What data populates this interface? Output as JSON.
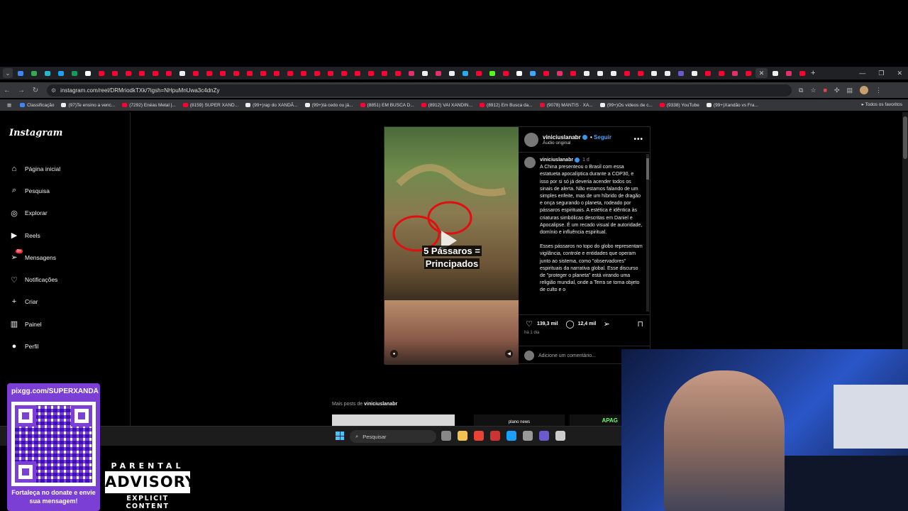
{
  "browser": {
    "tabs_favicon_colors": [
      "#4285f4",
      "#34a853",
      "#22b8cf",
      "#1da1f2",
      "#0f9d58",
      "#fff",
      "#ff0033",
      "#ff0033",
      "#ff0033",
      "#ff0033",
      "#ff0033",
      "#ff0033",
      "#eee",
      "#ff0033",
      "#ff0033",
      "#ff0033",
      "#ff0033",
      "#ff0033",
      "#ff0033",
      "#ff0033",
      "#ff0033",
      "#ff0033",
      "#ff0033",
      "#ff0033",
      "#ff0033",
      "#ff0033",
      "#ff0033",
      "#ff0033",
      "#ff0033",
      "#e1306c",
      "#eee",
      "#e1306c",
      "#eee",
      "#2aabee",
      "#ff0033",
      "#53fc18",
      "#ff0033",
      "#ffffff",
      "#3ea6ff",
      "#ff0033",
      "#e1306c",
      "#ff0033",
      "#eee",
      "#eee",
      "#eee",
      "#ff0033",
      "#ff0033",
      "#eee",
      "#eee",
      "#6a5acd",
      "#eee",
      "#ff0033",
      "#ff0033",
      "#e1306c",
      "#ff0033",
      "#eee",
      "#e1306c",
      "#ff0033"
    ],
    "url": "instagram.com/reel/DRMriodkTXk/?igsh=NHpuMnUwa3c4dnZy",
    "bookmarks": [
      {
        "label": "Classificação",
        "color": "#4285f4"
      },
      {
        "label": "(97)Te ensino a venc...",
        "color": "#eee"
      },
      {
        "label": "(7292) Enéas Metal |...",
        "color": "#ff0033"
      },
      {
        "label": "(8159) SUPER XAND...",
        "color": "#ff0033"
      },
      {
        "label": "(99+)rap do XANDÃ...",
        "color": "#eee"
      },
      {
        "label": "(99+)tá cedo ou já...",
        "color": "#eee"
      },
      {
        "label": "(8851) EM BUSCA D...",
        "color": "#ff0033"
      },
      {
        "label": "(8912) VAI XANDIN...",
        "color": "#ff0033"
      },
      {
        "label": "(8912) Em Busca da...",
        "color": "#ff0033"
      },
      {
        "label": "(9078) MANTIS · XA...",
        "color": "#ff0033"
      },
      {
        "label": "(99+)Os vídeos de c...",
        "color": "#eee"
      },
      {
        "label": "(9338) YouTube",
        "color": "#ff0033"
      },
      {
        "label": "(99+)Xandão vs Fra...",
        "color": "#eee"
      }
    ],
    "all_bookmarks": "Todos os favoritos"
  },
  "instagram": {
    "logo": "Instagram",
    "nav": [
      {
        "label": "Página inicial",
        "icon": "home-icon"
      },
      {
        "label": "Pesquisa",
        "icon": "search-icon"
      },
      {
        "label": "Explorar",
        "icon": "compass-icon"
      },
      {
        "label": "Reels",
        "icon": "reels-icon"
      },
      {
        "label": "Mensagens",
        "icon": "messages-icon",
        "badge": "9+"
      },
      {
        "label": "Notificações",
        "icon": "heart-icon"
      },
      {
        "label": "Criar",
        "icon": "plus-icon"
      },
      {
        "label": "Painel",
        "icon": "dashboard-icon"
      },
      {
        "label": "Perfil",
        "icon": "profile-icon"
      }
    ],
    "post": {
      "overlay_line1": "5 Pássaros =",
      "overlay_line2": "Principados",
      "username": "viniciuslanabr",
      "follow": "Seguir",
      "audio": "Áudio original",
      "time": "1 d",
      "caption_p1": "A China presenteou o Brasil com essa estatueta apocalíptica durante a COP30, e isso por si só já deveria acender todos os sinais de alerta. Não estamos falando de um simples enfeite, mas de um híbrido de dragão e onça segurando o planeta, rodeado por pássaros espirituais. A estética é idêntica às criaturas simbólicas descritas em Daniel e Apocalipse. É um recado visual de autoridade, domínio e influência espiritual.",
      "caption_p2": "Esses pássaros no topo do globo representam vigilância, controle e entidades que operam junto ao sistema, como \"observadores\" espirituais da narrativa global. Esse discurso de \"proteger o planeta\" está virando uma religião mundial, onde a Terra se torna objeto de culto e o",
      "likes": "139,3 mil",
      "comments": "12,4 mil",
      "ago": "há 1 dia",
      "comment_placeholder": "Adicione um comentário..."
    },
    "more_posts_prefix": "Mais posts de",
    "more_posts_user": "viniciuslanabr",
    "thumb2_text": "plano news",
    "thumb3_text": "APAG"
  },
  "taskbar": {
    "search": "Pesquisar",
    "icon_colors": [
      "#888",
      "#f2c14e",
      "#ea4335",
      "#c33",
      "#1a9fff",
      "#999",
      "#6a5acd",
      "#ccc"
    ]
  },
  "overlay": {
    "pix_title": "pixgg.com/SUPERXANDÃ",
    "pix_text": "Fortaleça no donate e envie sua mensagem!",
    "pa_top": "PARENTAL",
    "pa_mid": "ADVISORY",
    "pa_bot": "EXPLICIT CONTENT"
  }
}
